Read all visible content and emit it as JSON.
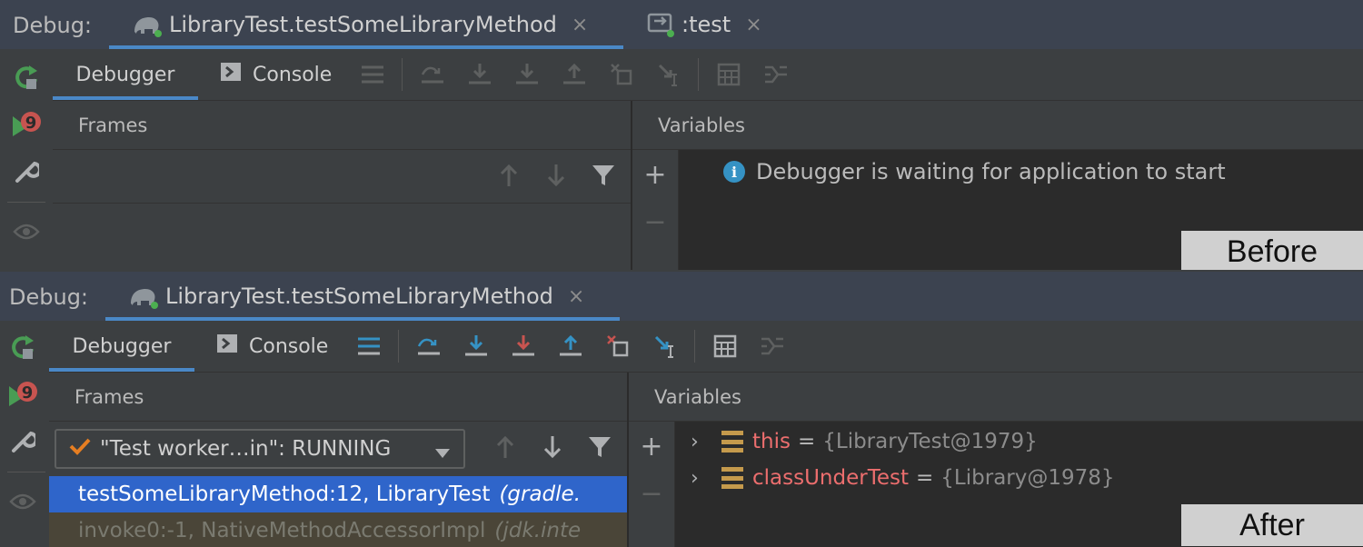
{
  "before": {
    "debug_label": "Debug:",
    "tabs": [
      {
        "label": "LibraryTest.testSomeLibraryMethod",
        "close": "×"
      },
      {
        "label": ":test",
        "close": "×"
      }
    ],
    "subtabs": {
      "debugger": "Debugger",
      "console": "Console"
    },
    "frames_header": "Frames",
    "variables_header": "Variables",
    "info_message": "Debugger is waiting for application to start",
    "stamp": "Before"
  },
  "after": {
    "debug_label": "Debug:",
    "tabs": [
      {
        "label": "LibraryTest.testSomeLibraryMethod",
        "close": "×"
      }
    ],
    "subtabs": {
      "debugger": "Debugger",
      "console": "Console"
    },
    "frames_header": "Frames",
    "variables_header": "Variables",
    "thread_combo": "\"Test worker…in\": RUNNING",
    "frames": [
      {
        "method": "testSomeLibraryMethod:12, LibraryTest",
        "location": "(gradle."
      },
      {
        "method": "invoke0:-1, NativeMethodAccessorImpl",
        "location": "(jdk.inte"
      }
    ],
    "variables": [
      {
        "name": "this",
        "eq": "=",
        "value": "{LibraryTest@1979}"
      },
      {
        "name": "classUnderTest",
        "eq": "=",
        "value": "{Library@1978}"
      }
    ],
    "stamp": "After"
  },
  "colors": {
    "accent": "#4a88c7",
    "selection": "#2f65ca",
    "step_blue": "#3592c4",
    "step_red": "#c75450",
    "rerun_green": "#499c54",
    "var_name": "#ec6e6e"
  },
  "icons": {
    "rerun": "rerun-icon",
    "resume": "resume-icon",
    "settings": "wrench-icon",
    "watch": "eye-icon",
    "frames_up": "arrow-up-icon",
    "frames_down": "arrow-down-icon",
    "filter": "filter-icon"
  }
}
